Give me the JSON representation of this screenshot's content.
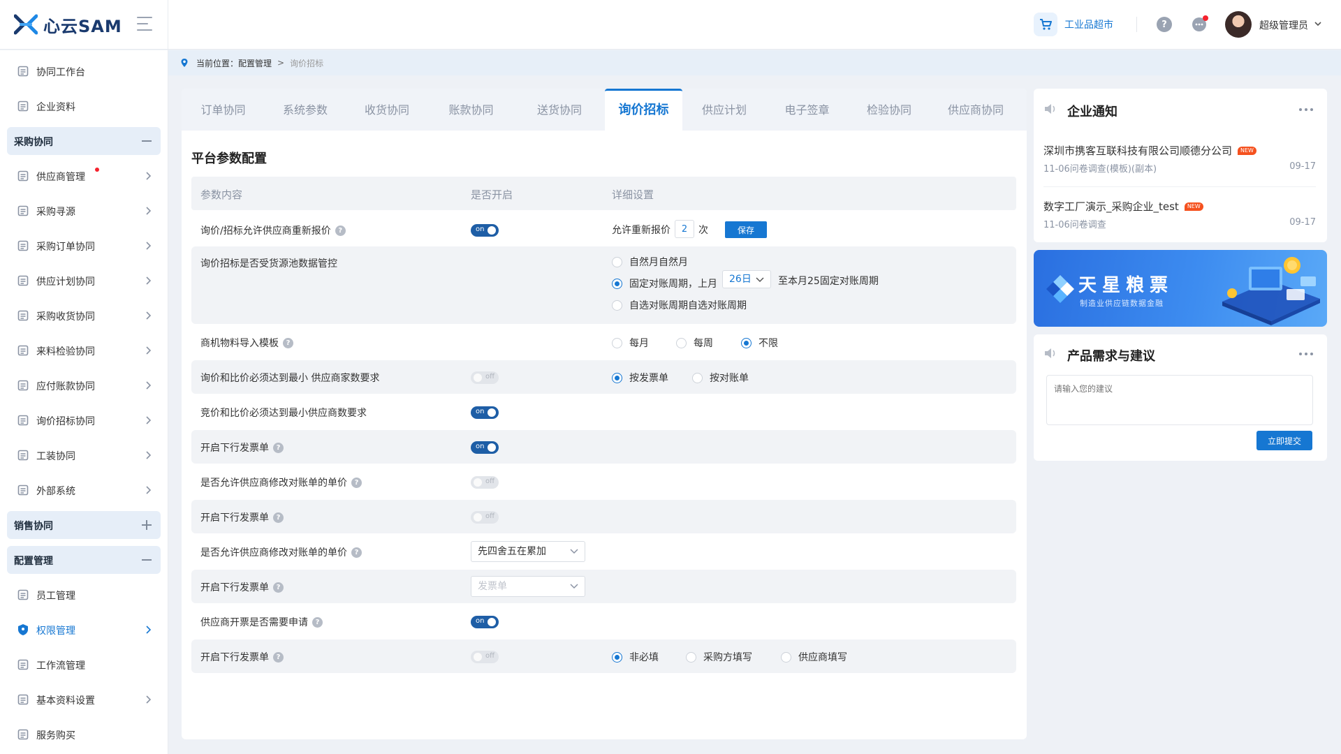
{
  "app": {
    "logo_text": "心云SAM"
  },
  "header": {
    "mall_label": "工业品超市",
    "user_name": "超级管理员"
  },
  "sidebar": {
    "items": [
      {
        "label": "协同工作台"
      },
      {
        "label": "企业资料"
      },
      {
        "label": "采购协同",
        "group": true
      },
      {
        "label": "供应商管理",
        "badge": true
      },
      {
        "label": "采购寻源"
      },
      {
        "label": "采购订单协同"
      },
      {
        "label": "供应计划协同"
      },
      {
        "label": "采购收货协同"
      },
      {
        "label": "来料检验协同"
      },
      {
        "label": "应付账款协同"
      },
      {
        "label": "询价招标协同"
      },
      {
        "label": "工装协同"
      },
      {
        "label": "外部系统"
      },
      {
        "label": "销售协同",
        "group": true
      },
      {
        "label": "配置管理",
        "group": true
      },
      {
        "label": "员工管理"
      },
      {
        "label": "权限管理",
        "active": true
      },
      {
        "label": "工作流管理"
      },
      {
        "label": "基本资料设置"
      },
      {
        "label": "服务购买"
      }
    ]
  },
  "breadcrumb": {
    "prefix": "当前位置：",
    "parent": "配置管理",
    "separator": ">",
    "current": "询价招标"
  },
  "tabs": [
    {
      "label": "订单协同"
    },
    {
      "label": "系统参数"
    },
    {
      "label": "收货协同"
    },
    {
      "label": "账款协同"
    },
    {
      "label": "送货协同"
    },
    {
      "label": "询价招标",
      "active": true
    },
    {
      "label": "供应计划"
    },
    {
      "label": "电子签章"
    },
    {
      "label": "检验协同"
    },
    {
      "label": "供应商协同"
    }
  ],
  "config": {
    "title": "平台参数配置",
    "columns": [
      "参数内容",
      "是否开启",
      "详细设置"
    ],
    "rows": [
      {
        "label": "询价/招标允许供应商重新报价",
        "help": true,
        "switch": "on",
        "detail": {
          "prefix": "允许重新报价",
          "value": "2",
          "suffix": "次",
          "button": "保存"
        }
      },
      {
        "label": "询价招标是否受货源池数据管控",
        "help": false,
        "detail": {
          "options": [
            "自然月自然月",
            "固定对账周期，上月",
            "自选对账周期自选对账周期"
          ],
          "selected_index": 1,
          "select_value": "26日",
          "after_select": "至本月25固定对账周期"
        }
      },
      {
        "label": "商机物料导入模板",
        "help": true,
        "detail": {
          "options": [
            "每月",
            "每周",
            "不限"
          ],
          "selected_index": 2
        }
      },
      {
        "label": "询价和比价必须达到最小 供应商家数要求",
        "help": false,
        "switch": "off",
        "detail": {
          "options": [
            "按发票单",
            "按对账单"
          ],
          "selected_index": 0
        }
      },
      {
        "label": "竞价和比价必须达到最小供应商数要求",
        "help": false,
        "switch": "on"
      },
      {
        "label": "开启下行发票单",
        "help": true,
        "switch": "on"
      },
      {
        "label": "是否允许供应商修改对账单的单价",
        "help": true,
        "switch": "off"
      },
      {
        "label": "开启下行发票单",
        "help": true,
        "switch": "off"
      },
      {
        "label": "是否允许供应商修改对账单的单价",
        "help": true,
        "select": {
          "value": "先四舍五在累加",
          "placeholder": false
        }
      },
      {
        "label": "开启下行发票单",
        "help": true,
        "select": {
          "value": "发票单",
          "placeholder": true
        }
      },
      {
        "label": "供应商开票是否需要申请",
        "help": true,
        "switch": "on"
      },
      {
        "label": "开启下行发票单",
        "help": true,
        "switch": "off",
        "detail": {
          "options": [
            "非必填",
            "采购方填写",
            "供应商填写"
          ],
          "selected_index": 0
        }
      }
    ],
    "switch_on_text": "on",
    "switch_off_text": "off"
  },
  "notices": {
    "title": "企业通知",
    "items": [
      {
        "title": "深圳市携客互联科技有限公司顺德分公司",
        "badge": "NEW",
        "subtitle": "11-06问卷调查(模板)(副本)",
        "date": "09-17"
      },
      {
        "title": "数字工厂演示_采购企业_test",
        "badge": "NEW",
        "subtitle": "11-06问卷调查",
        "date": "09-17"
      }
    ]
  },
  "banner": {
    "title": "天星粮票",
    "subtitle": "制造业供应链数据金融"
  },
  "suggestion": {
    "title": "产品需求与建议",
    "placeholder": "请输入您的建议",
    "submit_label": "立即提交"
  },
  "colors": {
    "primary": "#1677d2",
    "switch_on": "#1e5ea6",
    "badge_red": "#f5222d",
    "new_badge": "#f5511e"
  }
}
